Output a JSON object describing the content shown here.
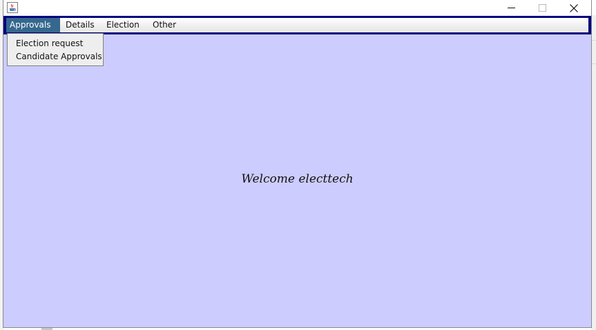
{
  "window": {
    "icon": "java-cup-icon",
    "controls": [
      "minimize-icon",
      "maximize-icon",
      "close-icon"
    ]
  },
  "menubar": {
    "items": [
      {
        "label": "Approvals",
        "active": true
      },
      {
        "label": "Details"
      },
      {
        "label": "Election"
      },
      {
        "label": "Other"
      }
    ]
  },
  "dropdown": {
    "items": [
      {
        "label": "Election request"
      },
      {
        "label": "Candidate Approvals"
      }
    ]
  },
  "main": {
    "welcome_text": "Welcome electtech"
  },
  "colors": {
    "menubar_border": "#000080",
    "active_menu": "#36688f",
    "content_bg": "#ccccfe"
  }
}
